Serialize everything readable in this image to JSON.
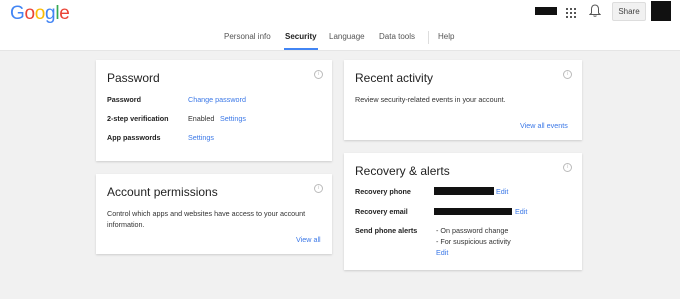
{
  "header": {
    "logo_letters": [
      "G",
      "o",
      "o",
      "g",
      "l",
      "e"
    ],
    "logo_colors": [
      "#4285f4",
      "#ea4335",
      "#fbbc05",
      "#4285f4",
      "#34a853",
      "#ea4335"
    ],
    "share_label": "Share"
  },
  "nav": {
    "items": [
      "Personal info",
      "Security",
      "Language",
      "Data tools",
      "Help"
    ],
    "active": "Security"
  },
  "password_card": {
    "title": "Password",
    "rows": [
      {
        "label": "Password",
        "value": "",
        "link": "Change password"
      },
      {
        "label": "2-step verification",
        "value": "Enabled",
        "link": "Settings"
      },
      {
        "label": "App passwords",
        "value": "",
        "link": "Settings"
      }
    ]
  },
  "permissions_card": {
    "title": "Account permissions",
    "description": "Control which apps and websites have access to your account information.",
    "link": "View all"
  },
  "activity_card": {
    "title": "Recent activity",
    "description": "Review security-related events in your account.",
    "link": "View all events"
  },
  "recovery_card": {
    "title": "Recovery & alerts",
    "phone_label": "Recovery phone",
    "phone_edit": "Edit",
    "email_label": "Recovery email",
    "email_edit": "Edit",
    "alerts_label": "Send phone alerts",
    "alerts_items": [
      "- On password change",
      "- For suspicious activity"
    ],
    "alerts_edit": "Edit"
  },
  "colors": {
    "link": "#3b78e7",
    "active_tab_underline": "#4285f4",
    "background": "#f1f1f1"
  }
}
